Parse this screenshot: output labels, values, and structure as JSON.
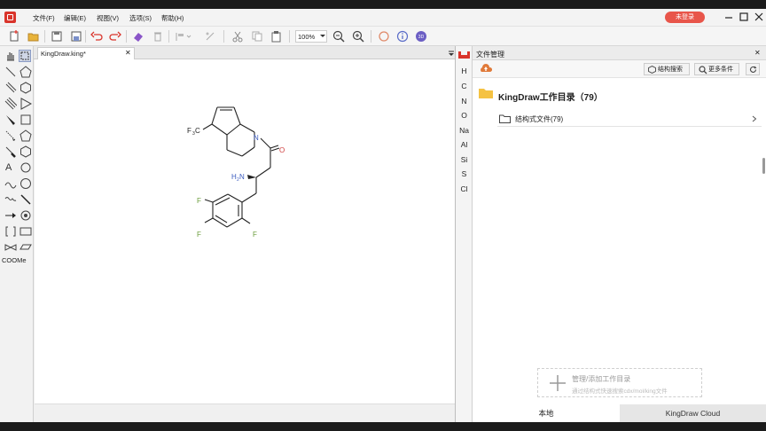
{
  "menubar": {
    "items": [
      "文件(F)",
      "编辑(E)",
      "视图(V)",
      "选项(S)",
      "帮助(H)"
    ],
    "login_label": "未登录"
  },
  "toolbar": {
    "zoom_value": "100%"
  },
  "document": {
    "tab_label": "KingDraw.king*",
    "close_symbol": "✕"
  },
  "molecule": {
    "cf3_label": "F",
    "cf3_sub": "3",
    "cf3_c": "C",
    "nh2_label": "H",
    "nh2_sub": "2",
    "nh2_n": "N",
    "n_label": "N",
    "o_label": "O",
    "f_labels": [
      "F",
      "F",
      "F"
    ]
  },
  "left_tools": {
    "chain_label": "COOMe"
  },
  "elements": [
    "H",
    "C",
    "N",
    "O",
    "Na",
    "Al",
    "Si",
    "S",
    "Cl"
  ],
  "file_panel": {
    "title": "文件管理",
    "close_symbol": "✕",
    "search_button": "结构搜索",
    "more_button": "更多条件",
    "workdir_label": "KingDraw工作目录（79）",
    "folder_label": "结构式文件(79)",
    "add_title": "管理/添加工作目录",
    "add_subtitle": "通过结构式快速搜索cdx/mol/king文件",
    "tab_local": "本地",
    "tab_cloud": "KingDraw Cloud"
  },
  "colors": {
    "accent_red": "#d9342b",
    "login_bg": "#e8554a",
    "folder_yellow": "#f5c242",
    "nitrogen_blue": "#3b5bbf",
    "oxygen_red": "#d04040",
    "fluorine_green": "#6a9c3a"
  }
}
